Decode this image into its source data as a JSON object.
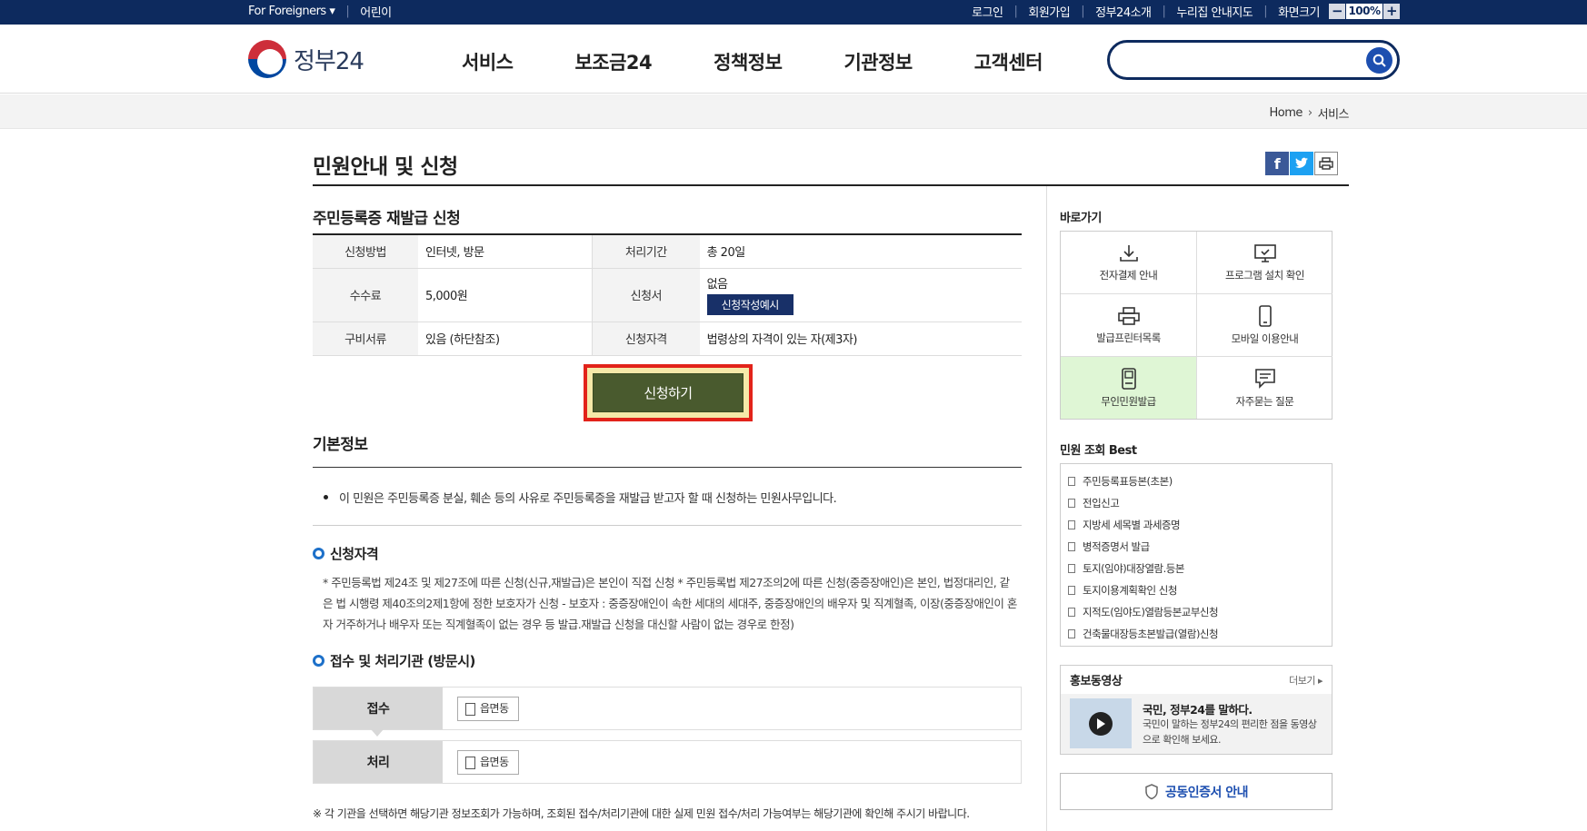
{
  "topbar": {
    "foreigners": "For Foreigners ▾",
    "kids": "어린이",
    "login": "로그인",
    "signup": "회원가입",
    "about": "정부24소개",
    "sitemap": "누리집 안내지도",
    "screen_size": "화면크기",
    "zoom_minus": "−",
    "zoom_value": "100%",
    "zoom_plus": "+"
  },
  "header": {
    "logo_text": "정부24",
    "nav": [
      "서비스",
      "보조금24",
      "정책정보",
      "기관정보",
      "고객센터"
    ],
    "search_placeholder": ""
  },
  "breadcrumb": {
    "home": "Home",
    "current": "서비스"
  },
  "page": {
    "title": "민원안내 및 신청",
    "service_title": "주민등록증 재발급 신청",
    "table": {
      "method_label": "신청방법",
      "method_value": "인터넷, 방문",
      "period_label": "처리기간",
      "period_value": "총 20일",
      "fee_label": "수수료",
      "fee_value": "5,000원",
      "form_label": "신청서",
      "form_value": "없음",
      "form_button": "신청작성예시",
      "docs_label": "구비서류",
      "docs_value": "있음 (하단참조)",
      "qual_label": "신청자격",
      "qual_value": "법령상의 자격이 있는 자(제3자)"
    },
    "apply_button": "신청하기",
    "basic_info_title": "기본정보",
    "basic_info_text": "이 민원은 주민등록증 분실, 훼손 등의 사유로 주민등록증을 재발급 받고자 할 때 신청하는 민원사무입니다.",
    "qualification_title": "신청자격",
    "qualification_text": "* 주민등록법 제24조 및 제27조에 따른 신청(신규,재발급)은 본인이 직접 신청 * 주민등록법 제27조의2에 따른 신청(중증장애인)은 본인, 법정대리인, 같은 법 시행령 제40조의2제1항에 정한 보호자가 신청 - 보호자 : 중증장애인이 속한 세대의 세대주, 중증장애인의 배우자 및 직계혈족, 이장(중증장애인이 혼자 거주하거나 배우자 또는 직계혈족이 없는 경우 등 발급.재발급 신청을 대신할 사람이 없는 경우로 한정)",
    "agency_title": "접수 및 처리기관 (방문시)",
    "receive_label": "접수",
    "receive_value": "읍면동",
    "process_label": "처리",
    "process_value": "읍면동",
    "agency_note": "※ 각 기관을 선택하면 해당기관 정보조회가 가능하며, 조회된 접수/처리기관에 대한 실제 민원 접수/처리 가능여부는 해당기관에 확인해 주시기 바랍니다."
  },
  "sidebar": {
    "quick_title": "바로가기",
    "quick": [
      "전자결제 안내",
      "프로그램 설치 확인",
      "발급프린터목록",
      "모바일 이용안내",
      "무인민원발급",
      "자주묻는 질문"
    ],
    "best_title": "민원 조회 Best",
    "best": [
      "주민등록표등본(초본)",
      "전입신고",
      "지방세 세목별 과세증명",
      "병적증명서 발급",
      "토지(임야)대장열람.등본",
      "토지이용계획확인 신청",
      "지적도(임야도)열람등본교부신청",
      "건축물대장등초본발급(열람)신청"
    ],
    "promo_title": "홍보동영상",
    "promo_more": "더보기 ▸",
    "promo_video_title": "국민, 정부24를 말하다.",
    "promo_video_desc": "국민이 말하는 정부24의 편리한 점을 동영상으로 확인해 보세요.",
    "cert_label": "공동인증서 안내"
  },
  "colors": {
    "navy": "#0d2a5e",
    "apply_green": "#495a2e",
    "highlight_red": "#e2231a",
    "active_tile": "#dff6d5"
  }
}
